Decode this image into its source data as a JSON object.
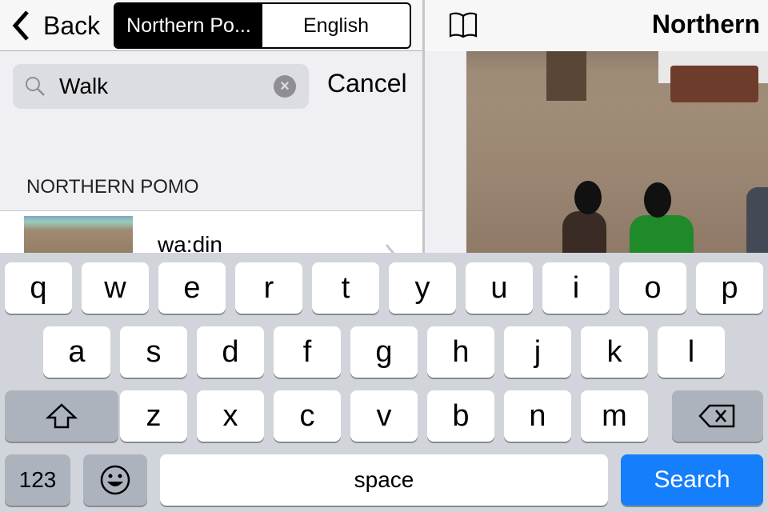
{
  "nav": {
    "back_label": "Back",
    "segments": [
      "Northern Po...",
      "English"
    ],
    "selected_segment": 0,
    "right_title": "Northern"
  },
  "search": {
    "value": "Walk",
    "cancel_label": "Cancel"
  },
  "results": {
    "section_header": "NORTHERN POMO",
    "items": [
      {
        "word": "wa:din"
      }
    ]
  },
  "keyboard": {
    "row1": [
      "q",
      "w",
      "e",
      "r",
      "t",
      "y",
      "u",
      "i",
      "o",
      "p"
    ],
    "row2": [
      "a",
      "s",
      "d",
      "f",
      "g",
      "h",
      "j",
      "k",
      "l"
    ],
    "row3": [
      "z",
      "x",
      "c",
      "v",
      "b",
      "n",
      "m"
    ],
    "numbers_label": "123",
    "space_label": "space",
    "search_label": "Search"
  },
  "colors": {
    "accent": "#157efb",
    "keyboard_bg": "#d1d5db"
  }
}
